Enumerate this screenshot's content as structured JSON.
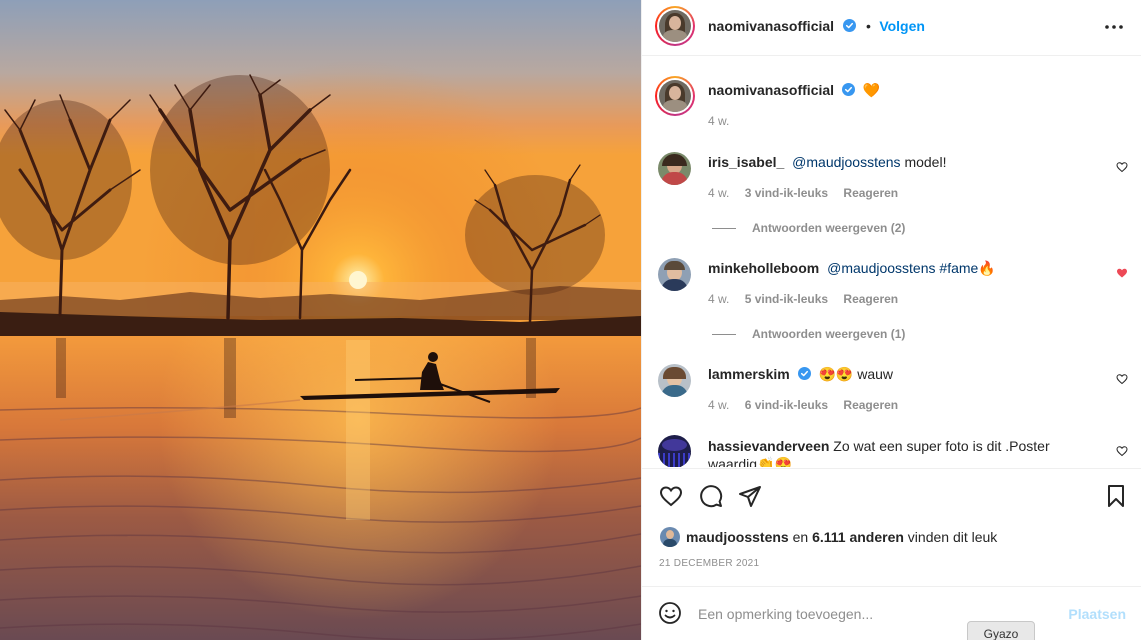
{
  "post": {
    "author": "naomivanasofficial",
    "follow_label": "Volgen",
    "caption_emoji": "🧡",
    "caption_age": "4 w."
  },
  "comments": [
    {
      "user": "iris_isabel_",
      "mention": "@maudjoosstens",
      "text": " model!",
      "age": "4 w.",
      "likes": "3 vind-ik-leuks",
      "reply_label": "Reageren",
      "replies": "Antwoorden weergeven (2)",
      "liked": false
    },
    {
      "user": "minkeholleboom",
      "mention": "@maudjoosstens",
      "hashtag": " #fame",
      "text": "🔥",
      "age": "4 w.",
      "likes": "5 vind-ik-leuks",
      "reply_label": "Reageren",
      "replies": "Antwoorden weergeven (1)",
      "liked": true
    },
    {
      "user": "lammerskim",
      "text": "😍😍 wauw",
      "age": "4 w.",
      "likes": "6 vind-ik-leuks",
      "reply_label": "Reageren",
      "liked": false,
      "verified": true
    },
    {
      "user": "hassievanderveen",
      "text": " Zo wat een super foto is dit .Poster waardig👏😍",
      "liked": false
    }
  ],
  "likes": {
    "user": "maudjoosstens",
    "connector": " en ",
    "count": "6.111 anderen",
    "suffix": " vinden dit leuk"
  },
  "date": "21 DECEMBER 2021",
  "comment_box": {
    "placeholder": "Een opmerking toevoegen...",
    "post_label": "Plaatsen"
  },
  "gyazo_label": "Gyazo",
  "colors": {
    "accent": "#0095f6",
    "heart_liked": "#ed4956",
    "muted": "#8e8e8e"
  }
}
